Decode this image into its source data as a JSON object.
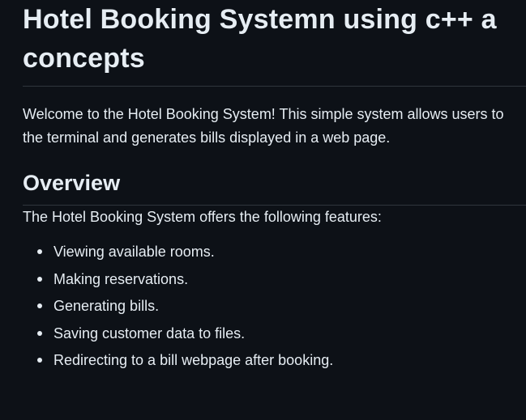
{
  "readme": {
    "title_line1": "Hotel Booking Systemn using c++ a",
    "title_line2": "concepts",
    "intro_line1": "Welcome to the Hotel Booking System! This simple system allows users to",
    "intro_line2": "the terminal and generates bills displayed in a web page.",
    "overview_heading": "Overview",
    "features_intro": "The Hotel Booking System offers the following features:",
    "features": [
      "Viewing available rooms.",
      "Making reservations.",
      "Generating bills.",
      "Saving customer data to files.",
      "Redirecting to a bill webpage after booking."
    ]
  },
  "colors": {
    "background": "#0d1117",
    "text": "#e6edf3",
    "divider": "#30363d"
  }
}
